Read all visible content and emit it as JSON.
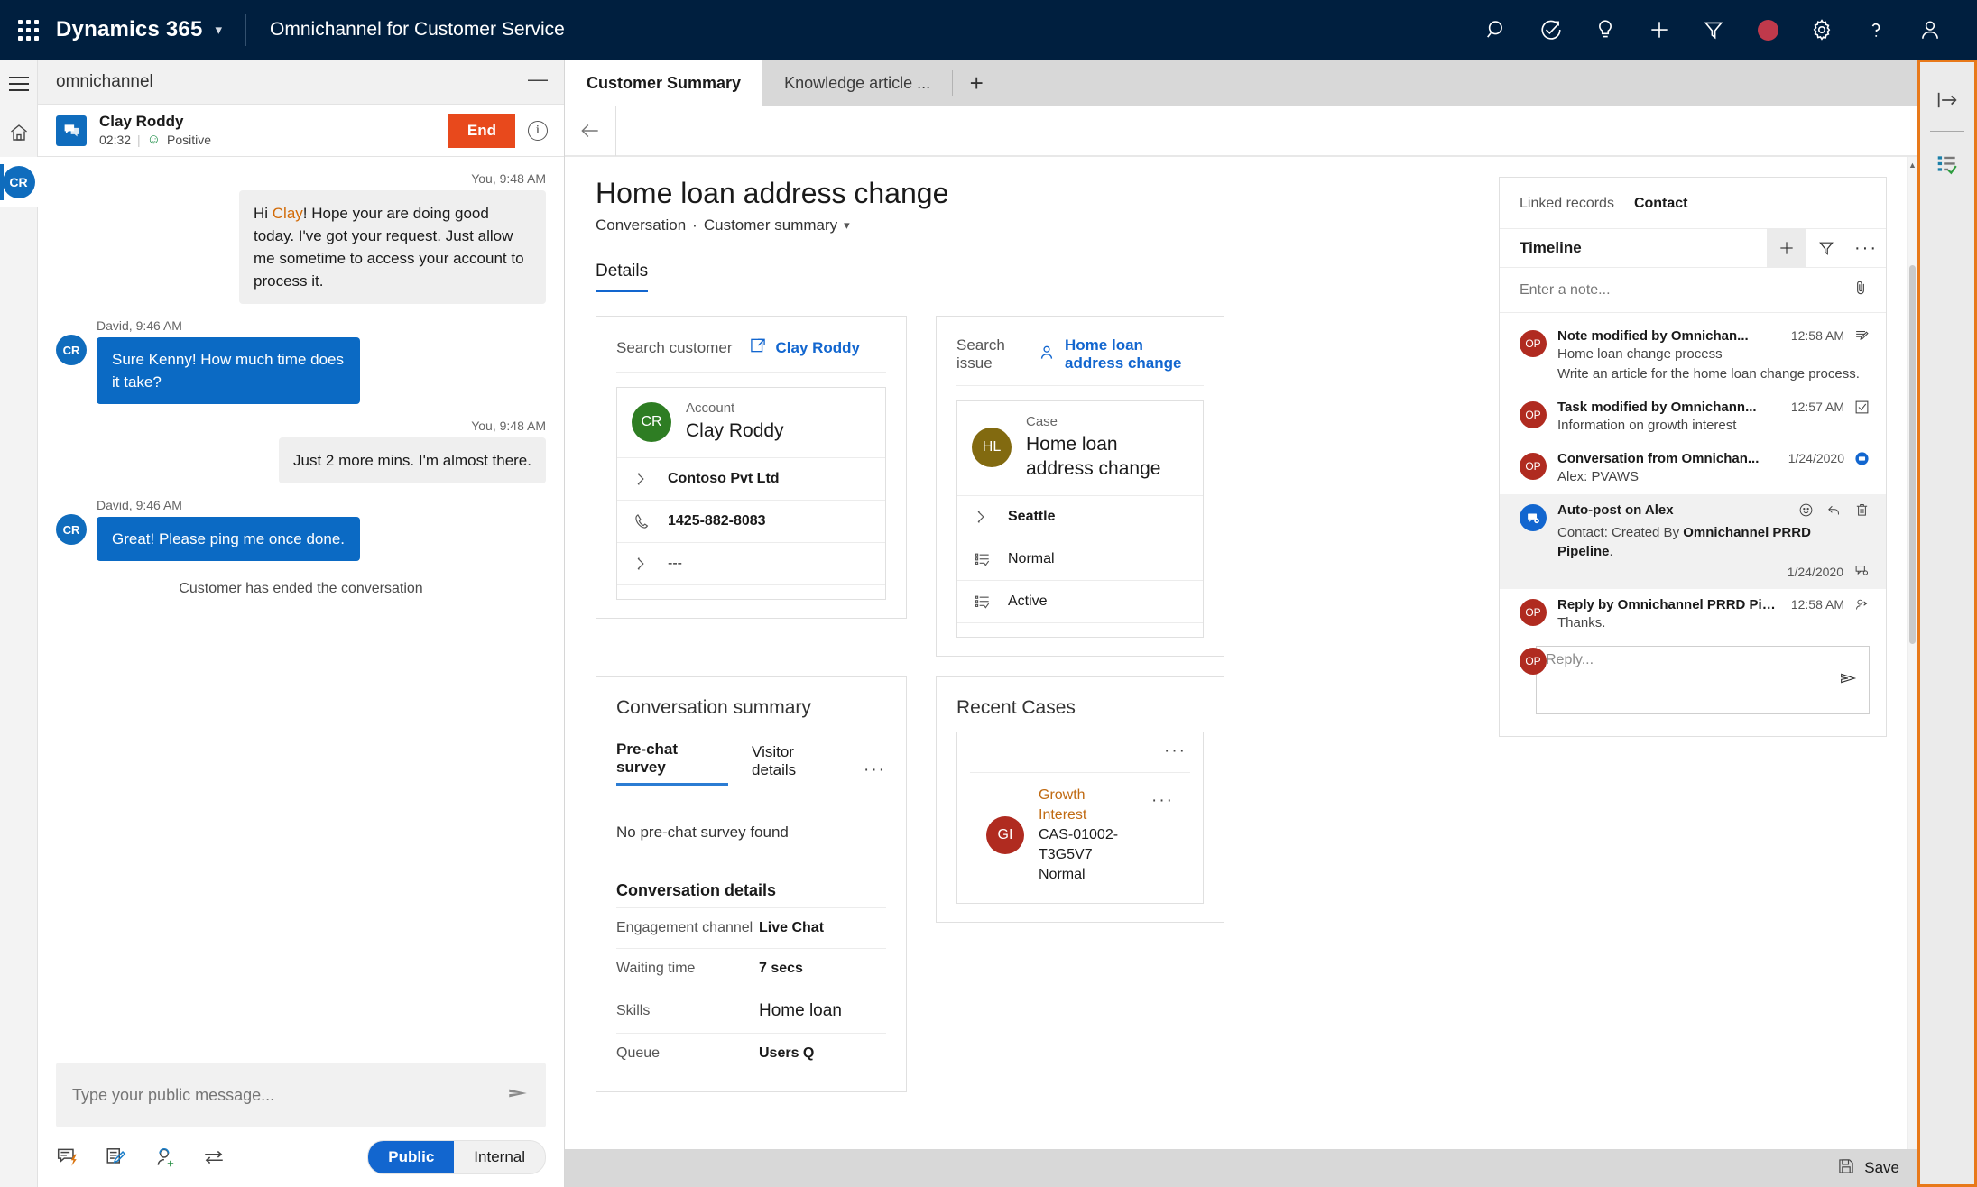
{
  "topbar": {
    "brand": "Dynamics 365",
    "app_name": "Omnichannel for Customer Service",
    "icons": [
      "search-icon",
      "check-circle-arrow-icon",
      "lightbulb-icon",
      "plus-icon",
      "filter-icon",
      "status-dot-icon",
      "gear-icon",
      "help-icon",
      "user-avatar-icon"
    ],
    "status_color": "#c0394b"
  },
  "rail": {
    "menu": "hamburger-icon",
    "home": "home-icon",
    "session_initials": "CR"
  },
  "chat": {
    "panel_title": "omnichannel",
    "minimize": "—",
    "customer_name": "Clay Roddy",
    "duration": "02:32",
    "sentiment": "Positive",
    "end_label": "End",
    "messages": [
      {
        "direction": "out",
        "meta": "You, 9:48 AM",
        "text_before": "Hi ",
        "highlight": "Clay",
        "text_after": "! Hope your are doing good today. I've got your request. Just allow me sometime to access your account to process it."
      },
      {
        "direction": "in",
        "meta": "David, 9:46 AM",
        "avatar": "CR",
        "text": "Sure Kenny! How much time does it take?"
      },
      {
        "direction": "out",
        "meta": "You, 9:48 AM",
        "text": "Just 2 more mins. I'm almost there."
      },
      {
        "direction": "in",
        "meta": "David, 9:46 AM",
        "avatar": "CR",
        "text": "Great! Please ping me once done."
      }
    ],
    "system_note": "Customer has ended the conversation",
    "composer_placeholder": "Type your public message...",
    "tools": [
      "quick-reply-icon",
      "note-icon",
      "consult-icon",
      "transfer-icon"
    ],
    "mode_public": "Public",
    "mode_internal": "Internal"
  },
  "tabs": {
    "items": [
      {
        "label": "Customer Summary",
        "active": true
      },
      {
        "label": "Knowledge article ...",
        "active": false
      }
    ],
    "add": "+"
  },
  "page": {
    "title": "Home loan address change",
    "breadcrumb_1": "Conversation",
    "breadcrumb_sep": "·",
    "breadcrumb_2": "Customer summary",
    "detail_tab": "Details"
  },
  "customer_card": {
    "search_label": "Search customer",
    "search_value": "Clay Roddy",
    "entity_type": "Account",
    "entity_name": "Clay Roddy",
    "initials": "CR",
    "avatar_color": "#2e7d23",
    "rows": [
      {
        "icon": "tag-icon",
        "value": "Contoso Pvt Ltd",
        "bold": true
      },
      {
        "icon": "phone-icon",
        "value": "1425-882-8083",
        "bold": true
      },
      {
        "icon": "tag-icon",
        "value": "---",
        "bold": false
      }
    ]
  },
  "case_card": {
    "search_label": "Search issue",
    "search_value": "Home loan address change",
    "entity_type": "Case",
    "entity_name": "Home loan address change",
    "initials": "HL",
    "avatar_color": "#826a10",
    "rows": [
      {
        "icon": "tag-icon",
        "value": "Seattle",
        "bold": true
      },
      {
        "icon": "list-check-icon",
        "value": "Normal",
        "bold": false
      },
      {
        "icon": "list-check-icon",
        "value": "Active",
        "bold": false
      }
    ]
  },
  "conversation_summary": {
    "heading": "Conversation summary",
    "tabs": [
      {
        "label": "Pre-chat survey",
        "active": true
      },
      {
        "label": "Visitor details",
        "active": false
      }
    ],
    "overflow": "···",
    "empty_text": "No pre-chat survey found",
    "details_heading": "Conversation details",
    "details": [
      {
        "key": "Engagement channel",
        "value": "Live Chat"
      },
      {
        "key": "Waiting time",
        "value": "7 secs"
      },
      {
        "key": "Skills",
        "value": "Home loan"
      },
      {
        "key": "Queue",
        "value": "Users Q"
      }
    ]
  },
  "recent_cases": {
    "heading": "Recent Cases",
    "overflow": "···",
    "items": [
      {
        "initials": "GI",
        "title": "Growth Interest",
        "number": "CAS-01002-T3G5V7",
        "priority": "Normal",
        "overflow": "···"
      }
    ]
  },
  "timeline": {
    "tabs": [
      {
        "label": "Linked records",
        "active": false
      },
      {
        "label": "Contact",
        "active": true
      }
    ],
    "heading": "Timeline",
    "actions": [
      "plus-icon",
      "filter-icon",
      "more-icon"
    ],
    "note_placeholder": "Enter a note...",
    "attach_icon": "paperclip-icon",
    "items": [
      {
        "initials": "OP",
        "title": "Note modified by Omnichan...",
        "time": "12:58 AM",
        "icon": "note-icon",
        "sub1": "Home loan change process",
        "sub2": "Write an article for the home loan change process.",
        "highlight": false
      },
      {
        "initials": "OP",
        "title": "Task modified by Omnichann...",
        "time": "12:57 AM",
        "icon": "checkbox-icon",
        "sub1": "Information on growth interest",
        "sub2": "",
        "highlight": false
      },
      {
        "initials": "OP",
        "title": "Conversation from Omnichan...",
        "time": "1/24/2020",
        "icon": "chat-badge-icon",
        "sub1": "Alex: PVAWS",
        "sub2": "",
        "highlight": false
      },
      {
        "initials": "",
        "avatar_icon": "post-config-icon",
        "title": "Auto-post on Alex",
        "time": "1/24/2020",
        "icon": "post-config-icon",
        "sub1_prefix": "Contact: Created By ",
        "sub1_bold": "Omnichannel PRRD Pipeline",
        "sub1_suffix": ".",
        "actions": [
          "emoji-icon",
          "reply-icon",
          "delete-icon"
        ],
        "highlight": true
      },
      {
        "initials": "OP",
        "title": "Reply by Omnichannel PRRD Pipeline",
        "time": "12:58 AM",
        "icon": "person-reply-icon",
        "sub1": "Thanks.",
        "sub2": "",
        "highlight": false
      }
    ],
    "reply": {
      "initials": "OP",
      "placeholder": "Reply...",
      "send_icon": "send-icon"
    }
  },
  "rightbar": {
    "icons": [
      "expand-panel-icon",
      "agent-script-icon"
    ],
    "highlight_color": "#e8791a"
  },
  "footer": {
    "save_label": "Save",
    "save_icon": "save-icon"
  }
}
